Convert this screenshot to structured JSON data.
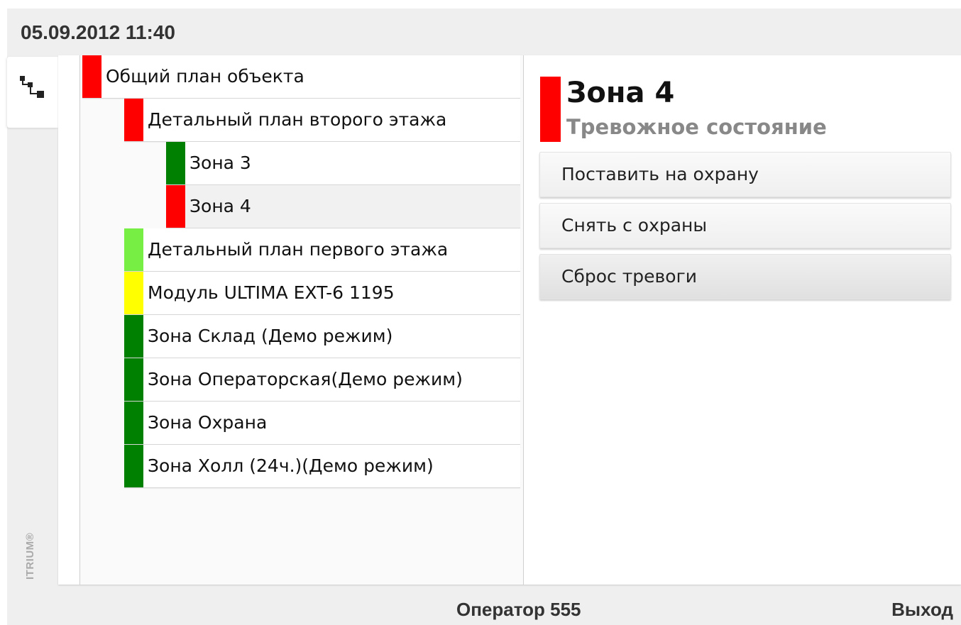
{
  "header": {
    "datetime": "05.09.2012 11:40"
  },
  "sidebar": {
    "tab_icon": "tree-structure-icon",
    "brand": "ITRIUM®"
  },
  "colors": {
    "alarm": "#ff0000",
    "armed": "#008000",
    "disarmed": "#77ee44",
    "warning": "#ffff00"
  },
  "tree": {
    "items": [
      {
        "label": "Общий план объекта",
        "level": 0,
        "status": "alarm"
      },
      {
        "label": "Детальный план второго этажа",
        "level": 1,
        "status": "alarm"
      },
      {
        "label": "Зона 3",
        "level": 2,
        "status": "armed"
      },
      {
        "label": "Зона 4",
        "level": 2,
        "status": "alarm",
        "selected": true
      },
      {
        "label": "Детальный план первого этажа",
        "level": 1,
        "status": "disarmed"
      },
      {
        "label": "Модуль ULTIMA EXT-6 1195",
        "level": 1,
        "status": "warning"
      },
      {
        "label": "Зона Склад (Демо режим)",
        "level": 1,
        "status": "armed"
      },
      {
        "label": "Зона Операторская(Демо режим)",
        "level": 1,
        "status": "armed"
      },
      {
        "label": "Зона Охрана",
        "level": 1,
        "status": "armed"
      },
      {
        "label": "Зона Холл (24ч.)(Демо режим)",
        "level": 1,
        "status": "armed"
      }
    ]
  },
  "detail": {
    "title": "Зона 4",
    "status": "Тревожное состояние",
    "status_color": "#ff0000",
    "actions": [
      {
        "label": "Поставить на охрану"
      },
      {
        "label": "Снять с охраны"
      },
      {
        "label": "Сброс тревоги",
        "active": true
      }
    ]
  },
  "footer": {
    "operator": "Оператор 555",
    "logout": "Выход"
  }
}
